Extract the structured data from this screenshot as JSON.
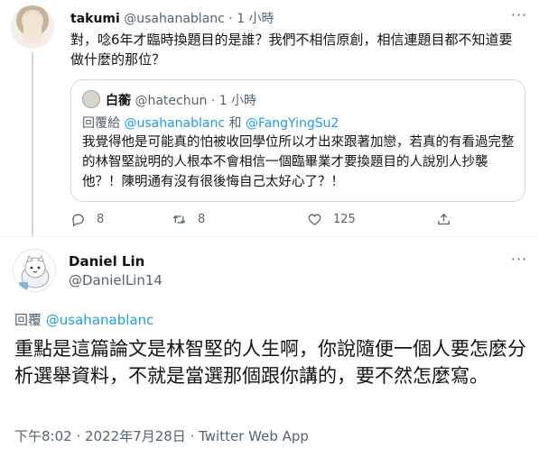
{
  "tweet1": {
    "name": "takumi",
    "handle": "@usahanablanc",
    "separator": "·",
    "time": "1 小時",
    "more_icon": "more-horizontal-icon",
    "text": "對，唸6年才臨時換題目的是誰？我們不相信原創，相信連題目都不知道要做什麼的那位？",
    "quote": {
      "name": "白蘅",
      "handle": "@hatechun",
      "separator": "·",
      "time": "1 小時",
      "reply_prefix": "回覆給",
      "reply_user1": "@usahanablanc",
      "reply_conj": "和",
      "reply_user2": "@FangYingSu2",
      "text": "我覺得他是可能真的怕被收回學位所以才出來跟著加戀，若真的有看過完整的林智堅說明的人根本不會相信一個臨畢業才要換題目的人說別人抄襲他？！陳明通有沒有很後悔自己太好心了？！"
    },
    "actions": {
      "reply_count": "8",
      "retweet_count": "8",
      "like_count": "125"
    }
  },
  "tweet2": {
    "name": "Daniel Lin",
    "handle": "@DanielLin14",
    "reply_prefix": "回覆",
    "reply_user": "@usahanablanc",
    "text": "重點是這篇論文是林智堅的人生啊，你說隨便一個人要怎麼分析選舉資料，不就是當選那個跟你講的，要不然怎麼寫。",
    "meta": "下午8:02 · 2022年7月28日 · Twitter Web App"
  },
  "colors": {
    "text": "#0f1419",
    "muted": "#536471",
    "link": "#1d9bf0",
    "border": "#cfd9de"
  }
}
